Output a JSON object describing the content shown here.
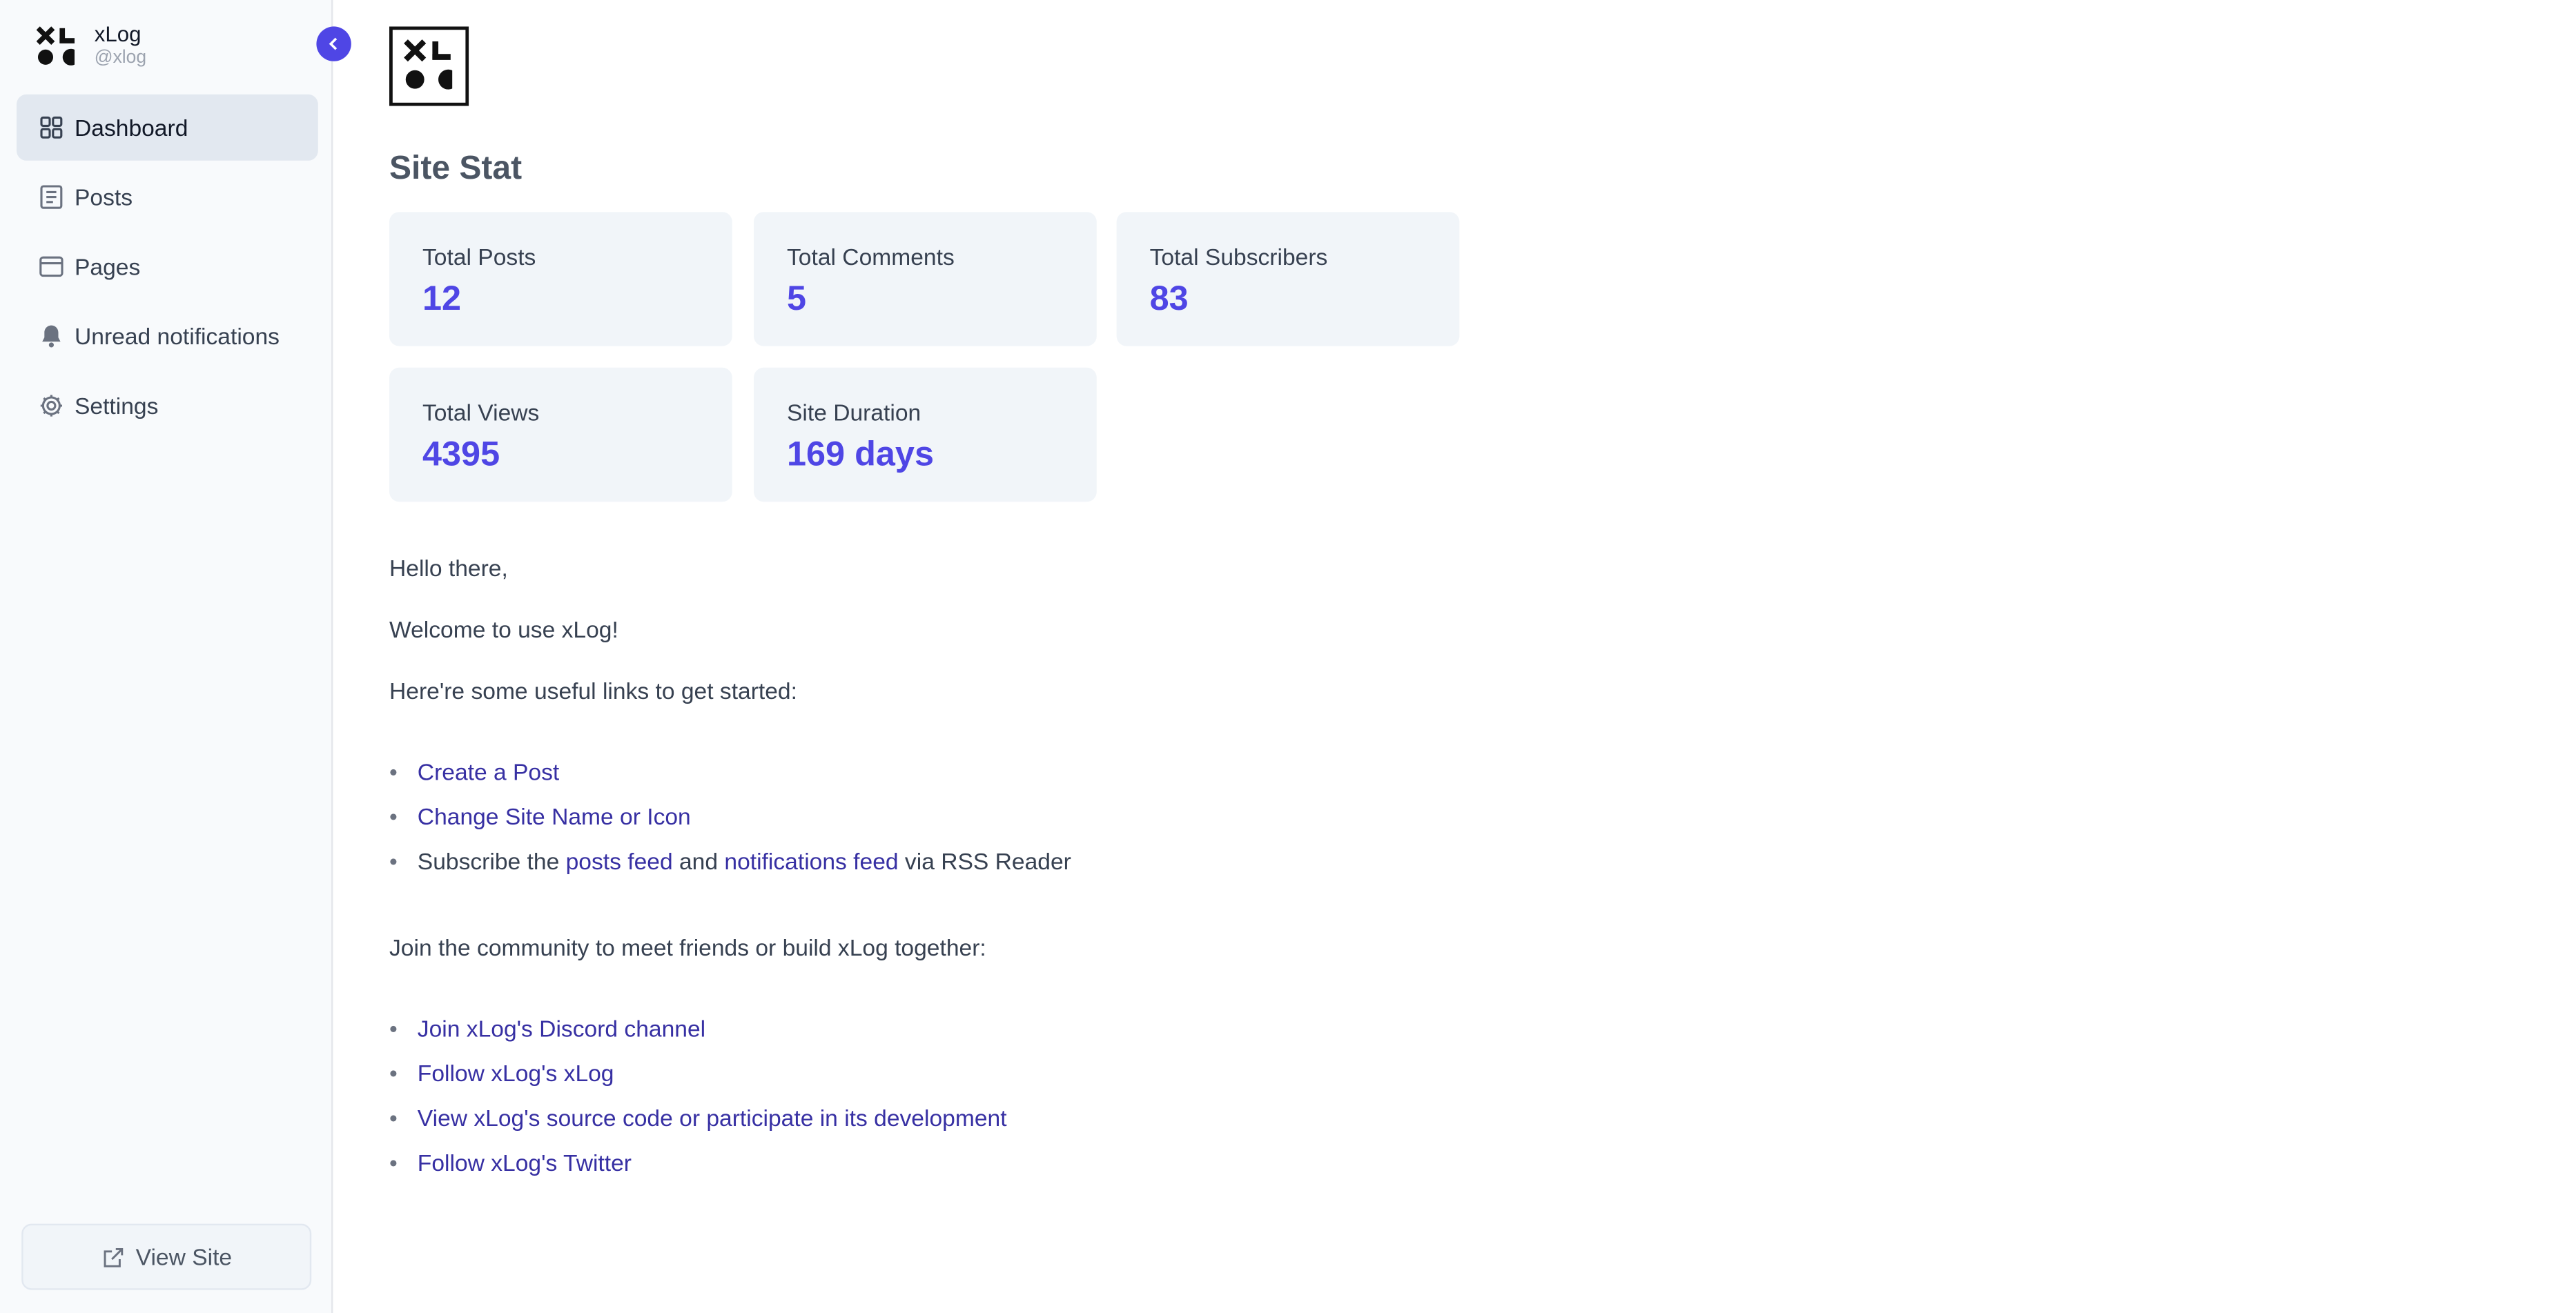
{
  "sidebar": {
    "brand": {
      "name": "xLog",
      "handle": "@xlog"
    },
    "items": [
      {
        "label": "Dashboard",
        "icon": "dashboard-grid-icon",
        "active": true
      },
      {
        "label": "Posts",
        "icon": "posts-document-icon",
        "active": false
      },
      {
        "label": "Pages",
        "icon": "pages-window-icon",
        "active": false
      },
      {
        "label": "Unread notifications",
        "icon": "bell-icon",
        "active": false
      },
      {
        "label": "Settings",
        "icon": "gear-icon",
        "active": false
      }
    ],
    "view_site_label": "View Site",
    "collapse_icon": "chevron-left-icon"
  },
  "main": {
    "section_title": "Site Stat",
    "stats": [
      {
        "label": "Total Posts",
        "value": "12"
      },
      {
        "label": "Total Comments",
        "value": "5"
      },
      {
        "label": "Total Subscribers",
        "value": "83"
      },
      {
        "label": "Total Views",
        "value": "4395"
      },
      {
        "label": "Site Duration",
        "value": "169 days"
      }
    ],
    "greeting": "Hello there,",
    "welcome": "Welcome to use xLog!",
    "links_intro": "Here're some useful links to get started:",
    "start_links": {
      "create_post": "Create a Post",
      "change_site": "Change Site Name or Icon",
      "subscribe_prefix": "Subscribe the ",
      "posts_feed": "posts feed",
      "and": " and ",
      "notifications_feed": "notifications feed",
      "subscribe_suffix": " via RSS Reader"
    },
    "community_intro": "Join the community to meet friends or build xLog together:",
    "community_links": [
      "Join xLog's Discord channel",
      "Follow xLog's xLog",
      "View xLog's source code or participate in its development",
      "Follow xLog's Twitter"
    ]
  },
  "colors": {
    "accent": "#4f46e5",
    "link": "#3730a3",
    "card_bg": "#f1f5f9",
    "sidebar_bg": "#f8fafc"
  }
}
